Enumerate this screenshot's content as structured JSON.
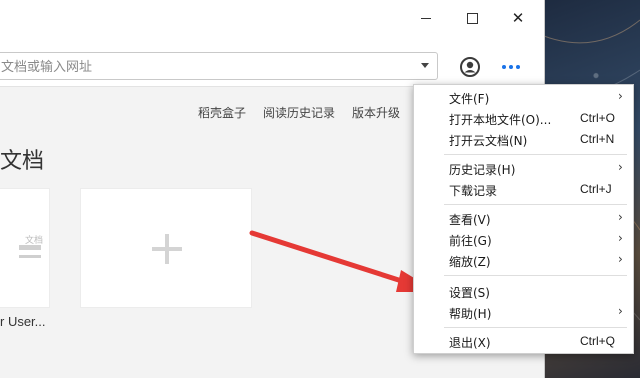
{
  "window": {
    "controls": {
      "minimize": "minimize",
      "maximize": "maximize",
      "close": "✕"
    }
  },
  "toolbar": {
    "address_placeholder": "文档或输入网址",
    "profile_icon": "user-icon",
    "more_icon": "more-icon"
  },
  "content": {
    "links": [
      "稻壳盒子",
      "阅读历史记录",
      "版本升级"
    ],
    "section_title": "文档",
    "card_caption": "r User...",
    "card_doc_text": "文档"
  },
  "menu": {
    "items": [
      {
        "label": "文件(F)",
        "shortcut": "",
        "submenu": true
      },
      {
        "label": "打开本地文件(O)...",
        "shortcut": "Ctrl+O",
        "submenu": false
      },
      {
        "label": "打开云文档(N)",
        "shortcut": "Ctrl+N",
        "submenu": false
      },
      {
        "label": "历史记录(H)",
        "shortcut": "",
        "submenu": true
      },
      {
        "label": "下载记录",
        "shortcut": "Ctrl+J",
        "submenu": false
      },
      {
        "label": "查看(V)",
        "shortcut": "",
        "submenu": true
      },
      {
        "label": "前往(G)",
        "shortcut": "",
        "submenu": true
      },
      {
        "label": "缩放(Z)",
        "shortcut": "",
        "submenu": true
      },
      {
        "label": "设置(S)",
        "shortcut": "",
        "submenu": false
      },
      {
        "label": "帮助(H)",
        "shortcut": "",
        "submenu": true
      },
      {
        "label": "退出(X)",
        "shortcut": "Ctrl+Q",
        "submenu": false
      }
    ],
    "submenu_glyph": "›"
  },
  "colors": {
    "accent": "#1a73e8",
    "arrow": "#e53935"
  }
}
